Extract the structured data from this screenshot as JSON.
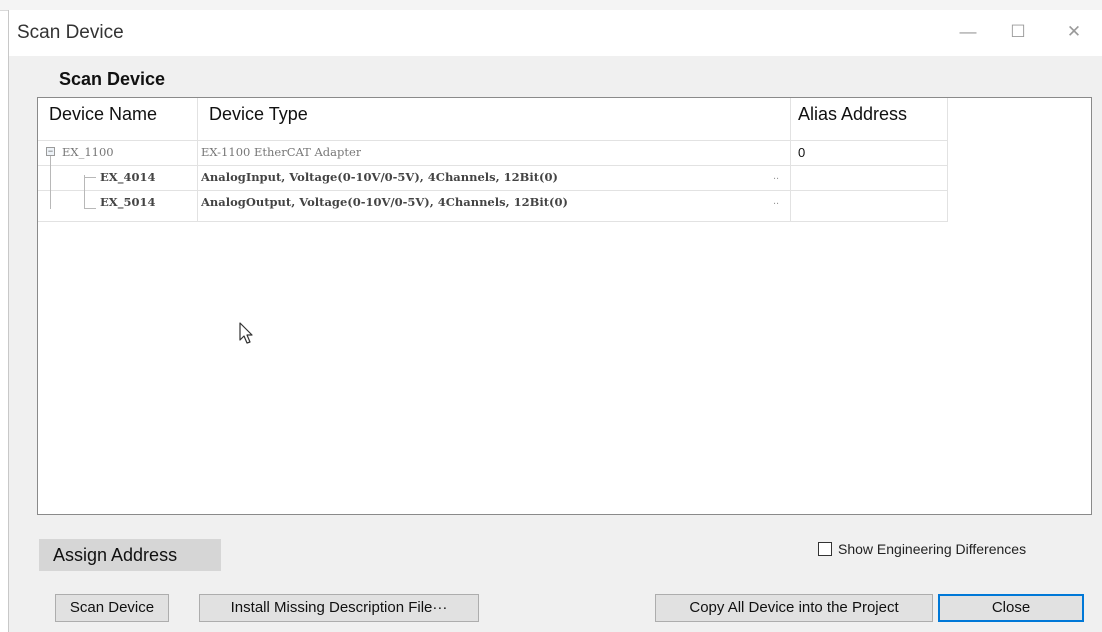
{
  "window": {
    "title": "Scan Device",
    "controls": {
      "minimize": "—",
      "maximize": "☐",
      "close": "✕"
    }
  },
  "group": {
    "title": "Scan Device"
  },
  "table": {
    "columns": [
      "Device Name",
      "Device Type",
      "Alias Address"
    ],
    "rows": [
      {
        "name": "EX_1100",
        "type": "EX-1100 EtherCAT Adapter",
        "alias": "0",
        "expander": "−",
        "has_button": false
      },
      {
        "name": "EX_4014",
        "type": "AnalogInput, Voltage(0-10V/0-5V), 4Channels, 12Bit(0)",
        "alias": "",
        "button": "..",
        "has_button": true
      },
      {
        "name": "EX_5014",
        "type": "AnalogOutput, Voltage(0-10V/0-5V), 4Channels, 12Bit(0)",
        "alias": "",
        "button": "..",
        "has_button": true
      }
    ]
  },
  "assign_address": {
    "label": "Assign Address"
  },
  "show_engineering_differences": {
    "label": "Show Engineering Differences",
    "checked": false
  },
  "buttons": {
    "scan": "Scan Device",
    "install": "Install Missing Description File···",
    "copy_all": "Copy All Device into the Project",
    "close": "Close"
  },
  "colors": {
    "accent": "#0078d7",
    "background": "#f0f0f0",
    "border": "#8a8a8a"
  }
}
